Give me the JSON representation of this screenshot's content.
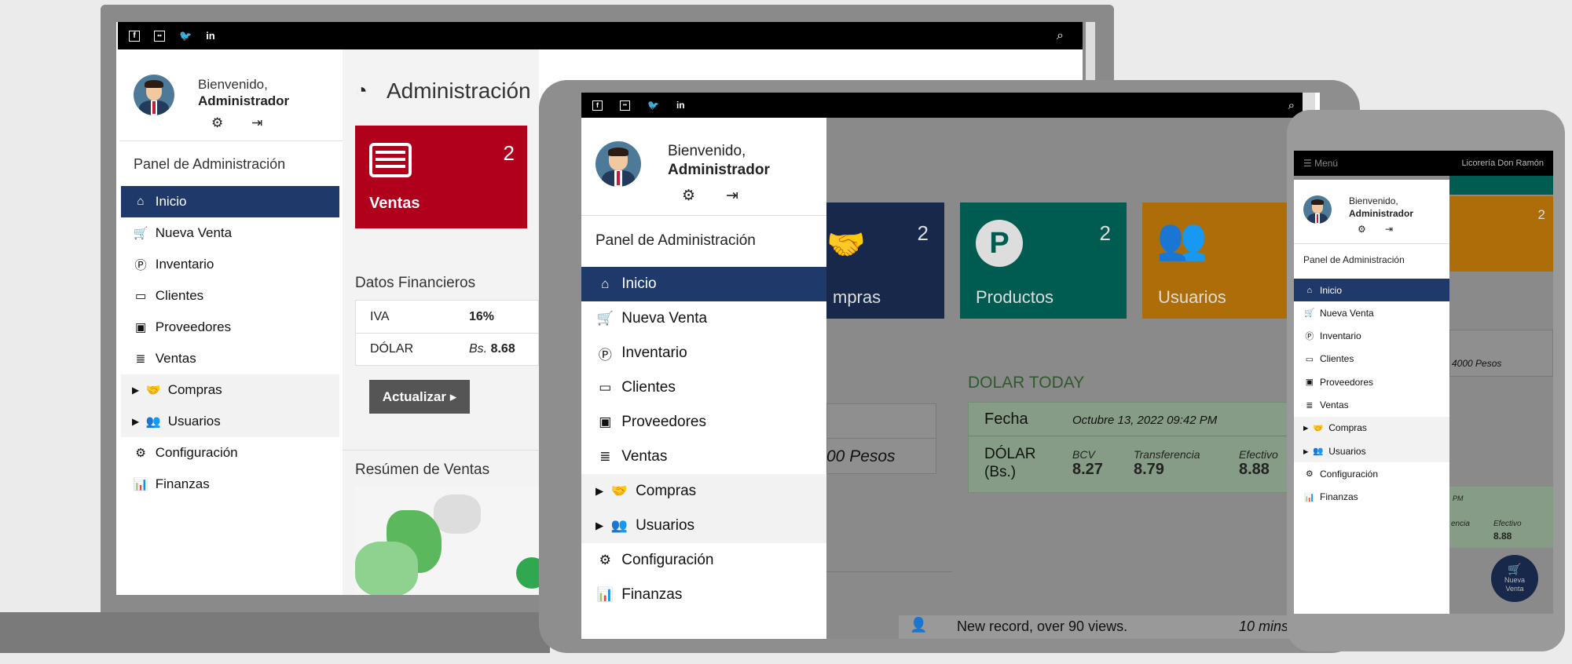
{
  "laptop": {
    "welcome": "Bienvenido,",
    "user": "Administrador",
    "panel_title": "Panel de Administración",
    "page_title": "Administración",
    "menu": [
      {
        "label": "Inicio",
        "icon": "⌂"
      },
      {
        "label": "Nueva Venta",
        "icon": "🛒"
      },
      {
        "label": "Inventario",
        "icon": "P"
      },
      {
        "label": "Clientes",
        "icon": "▭"
      },
      {
        "label": "Proveedores",
        "icon": "▣"
      },
      {
        "label": "Ventas",
        "icon": "≣"
      },
      {
        "label": "Compras",
        "icon": "🤝"
      },
      {
        "label": "Usuarios",
        "icon": "👥"
      },
      {
        "label": "Configuración",
        "icon": "⚙"
      },
      {
        "label": "Finanzas",
        "icon": "📊"
      }
    ],
    "ventas_card": {
      "count": "2",
      "label": "Ventas"
    },
    "financial": {
      "title": "Datos Financieros",
      "rows": [
        {
          "label": "IVA",
          "value": "16%"
        },
        {
          "label": "DÓLAR",
          "prefix": "Bs.",
          "value": "8.68"
        }
      ],
      "button": "Actualizar ▸"
    },
    "sales_summary": "Resúmen de Ventas"
  },
  "tablet": {
    "welcome": "Bienvenido,",
    "user": "Administrador",
    "panel_title": "Panel de Administración",
    "menu": [
      {
        "label": "Inicio"
      },
      {
        "label": "Nueva Venta"
      },
      {
        "label": "Inventario"
      },
      {
        "label": "Clientes"
      },
      {
        "label": "Proveedores"
      },
      {
        "label": "Ventas"
      },
      {
        "label": "Compras"
      },
      {
        "label": "Usuarios"
      },
      {
        "label": "Configuración"
      },
      {
        "label": "Finanzas"
      }
    ],
    "cards": [
      {
        "count": "2",
        "label": "mpras",
        "color": "#1f3a6a"
      },
      {
        "count": "2",
        "label": "Productos",
        "color": "#00796b"
      },
      {
        "count": "2",
        "label": "Usuarios",
        "color": "#e8930c"
      }
    ],
    "pesos_text": "00 Pesos",
    "dolar_title": "DOLAR TODAY",
    "fecha_label": "Fecha",
    "fecha_value": "Octubre 13, 2022 09:42 PM",
    "dolar_label": "DÓLAR (Bs.)",
    "rates": [
      {
        "name": "BCV",
        "value": "8.27"
      },
      {
        "name": "Transferencia",
        "value": "8.79"
      },
      {
        "name": "Efectivo",
        "value": "8.88"
      }
    ],
    "record_text": "New record, over 90 views.",
    "record_time": "10 mins"
  },
  "phone": {
    "menu_label": "☰ Menú",
    "brand": "Licorería Don Ramón",
    "welcome": "Bienvenido,",
    "user": "Administrador",
    "panel_title": "Panel de Administración",
    "menu": [
      {
        "label": "Inicio"
      },
      {
        "label": "Nueva Venta"
      },
      {
        "label": "Inventario"
      },
      {
        "label": "Clientes"
      },
      {
        "label": "Proveedores"
      },
      {
        "label": "Ventas"
      },
      {
        "label": "Compras"
      },
      {
        "label": "Usuarios"
      },
      {
        "label": "Configuración"
      },
      {
        "label": "Finanzas"
      }
    ],
    "card_count": "2",
    "pesos_text": "4000 Pesos",
    "pm_text": "PM",
    "rate_label": "Efectivo",
    "rate_partial": "encia",
    "rate_value": "8.88",
    "fab_label": "Nueva Venta"
  },
  "colors": {
    "active": "#1f3a6a",
    "red": "#b0001c",
    "teal": "#00796b",
    "orange": "#e8930c",
    "green_text": "#3a8a3a"
  }
}
